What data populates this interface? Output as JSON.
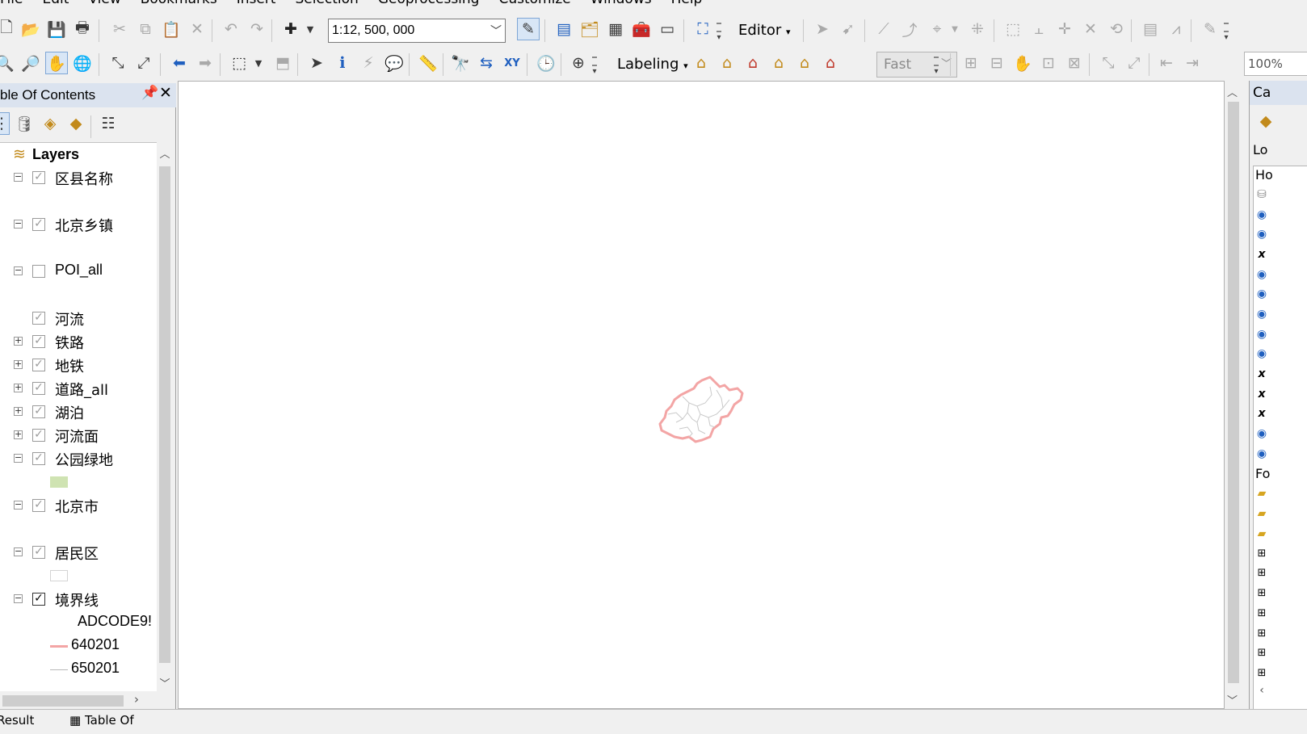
{
  "menu": [
    "File",
    "Edit",
    "View",
    "Bookmarks",
    "Insert",
    "Selection",
    "Geoprocessing",
    "Customize",
    "Windows",
    "Help"
  ],
  "toolbar": {
    "scale_value": "1:12, 500, 000",
    "editor_label": "Editor",
    "labeling_label": "Labeling",
    "fast_label": "Fast",
    "zoom_value": "100%"
  },
  "toc": {
    "title": "ble Of Contents",
    "root_label": "Layers",
    "layers": [
      {
        "name": "区县名称",
        "checked": true,
        "expander": "minus"
      },
      {
        "name": "北京乡镇",
        "checked": true,
        "expander": "minus"
      },
      {
        "name": "POI_all",
        "checked": false,
        "expander": "minus"
      },
      {
        "name": "河流",
        "checked": true,
        "expander": "none"
      },
      {
        "name": "铁路",
        "checked": true,
        "expander": "plus"
      },
      {
        "name": "地铁",
        "checked": true,
        "expander": "plus"
      },
      {
        "name": "道路_all",
        "checked": true,
        "expander": "plus"
      },
      {
        "name": "湖泊",
        "checked": true,
        "expander": "plus"
      },
      {
        "name": "河流面",
        "checked": true,
        "expander": "plus"
      },
      {
        "name": "公园绿地",
        "checked": true,
        "expander": "minus"
      },
      {
        "name": "北京市",
        "checked": true,
        "expander": "minus"
      },
      {
        "name": "居民区",
        "checked": true,
        "expander": "minus"
      },
      {
        "name": "境界线",
        "checked": true,
        "expander": "minus"
      }
    ],
    "field_label": "ADCODE9!",
    "legend_values": [
      "640201",
      "650201"
    ],
    "colors": {
      "park_swatch": "#cfe3b2",
      "boundary_640201": "#f3a5a5",
      "boundary_650201": "#b8b8b8"
    }
  },
  "catalog": {
    "title": "Ca",
    "location_label": "Lo",
    "home_label": "Ho",
    "folder_label": "Fo"
  },
  "bottom": {
    "results_tab": "Result",
    "toc_tab": "Table Of"
  },
  "map": {
    "boundary_color": "#f3a5a5",
    "district_color": "#c9c9c9"
  }
}
